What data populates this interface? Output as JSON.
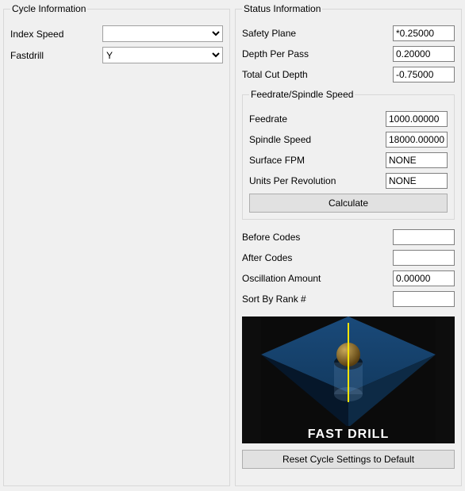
{
  "cycle_info": {
    "legend": "Cycle Information",
    "index_speed_label": "Index Speed",
    "index_speed_value": "",
    "fastdrill_label": "Fastdrill",
    "fastdrill_value": "Y"
  },
  "status_info": {
    "legend": "Status Information",
    "safety_plane_label": "Safety Plane",
    "safety_plane_value": "*0.25000",
    "depth_per_pass_label": "Depth Per Pass",
    "depth_per_pass_value": "0.20000",
    "total_cut_depth_label": "Total Cut Depth",
    "total_cut_depth_value": "-0.75000",
    "feedrate_spindle": {
      "legend": "Feedrate/Spindle Speed",
      "feedrate_label": "Feedrate",
      "feedrate_value": "1000.00000",
      "spindle_speed_label": "Spindle Speed",
      "spindle_speed_value": "18000.00000",
      "surface_fpm_label": "Surface FPM",
      "surface_fpm_value": "NONE",
      "units_per_rev_label": "Units Per Revolution",
      "units_per_rev_value": "NONE",
      "calculate_button": "Calculate"
    },
    "before_codes_label": "Before Codes",
    "before_codes_value": "",
    "after_codes_label": "After Codes",
    "after_codes_value": "",
    "oscillation_label": "Oscillation Amount",
    "oscillation_value": "0.00000",
    "sort_by_rank_label": "Sort By Rank #",
    "sort_by_rank_value": "",
    "illustration_caption": "FAST DRILL",
    "reset_button": "Reset Cycle Settings to Default"
  }
}
